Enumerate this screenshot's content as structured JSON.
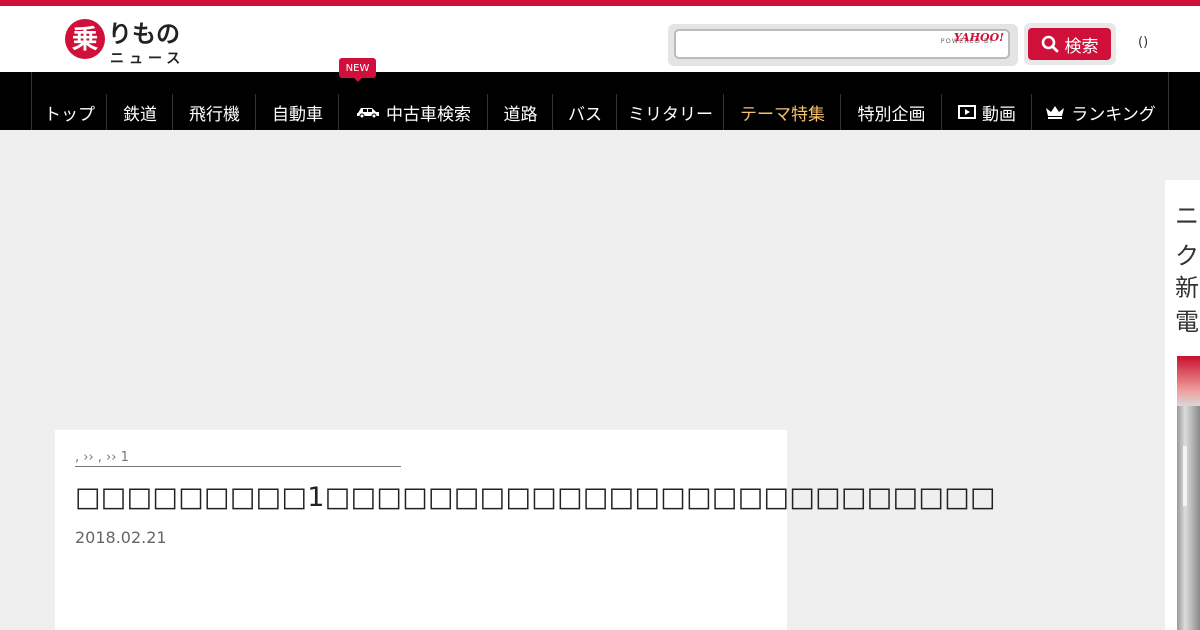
{
  "header": {
    "logo_text": "乗りものニュース",
    "search": {
      "placeholder": "",
      "powered_by": "POWERED BY",
      "provider": "YAHOO!",
      "button_label": "検索"
    },
    "user_parens": "()"
  },
  "nav": {
    "items": [
      {
        "label": "トップ"
      },
      {
        "label": "鉄道"
      },
      {
        "label": "飛行機"
      },
      {
        "label": "自動車"
      },
      {
        "label": "中古車検索",
        "icon": "car-icon"
      },
      {
        "label": "道路"
      },
      {
        "label": "バス"
      },
      {
        "label": "ミリタリー"
      },
      {
        "label": "テーマ特集",
        "accent": "#f5c26b"
      },
      {
        "label": "特別企画"
      },
      {
        "label": "動画",
        "icon": "video-icon"
      },
      {
        "label": "ランキング",
        "icon": "crown-icon"
      }
    ],
    "new_badge": "NEW"
  },
  "article": {
    "breadcrumb": ", ›› , ›› 1",
    "breadcrumb_number": "1",
    "title": "□□□□□□□□□1□□□□□□□□□□□□□□□□□□□□□□□□□□",
    "date": "2018.02.21"
  },
  "side_ad": {
    "lines": [
      "ニ",
      "ク",
      "新",
      "電"
    ]
  },
  "colors": {
    "brand": "#d0103a",
    "nav_bg": "#000000",
    "accent": "#f5c26b",
    "page_bg": "#efefef"
  }
}
